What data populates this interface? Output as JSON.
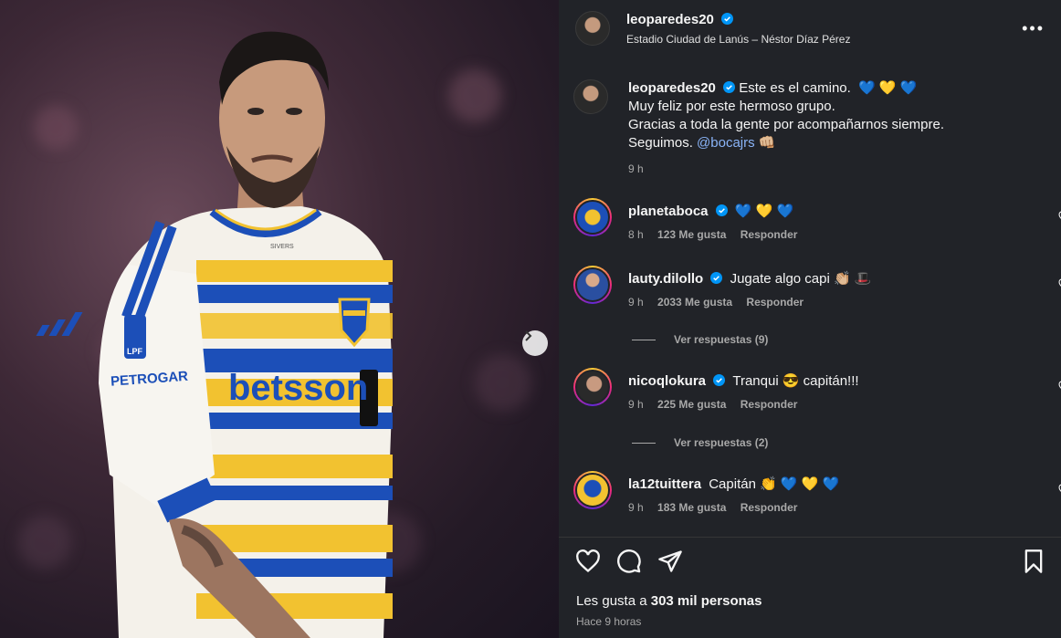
{
  "post": {
    "author": "leoparedes20",
    "location": "Estadio Ciudad de Lanús – Néstor Díaz Pérez",
    "more_label": "•••",
    "caption": {
      "author": "leoparedes20",
      "text_l1_pre": "Este es el camino.",
      "text_l1_emoji": "💙 💛 💙",
      "text_l2": "Muy feliz por este hermoso grupo.",
      "text_l3": "Gracias a toda la gente por acompañarnos siempre.",
      "text_l4": "Seguimos.",
      "mention": "@bocajrs",
      "text_l4_emoji": "👊🏼",
      "time": "9 h"
    },
    "jersey_text": "betsson",
    "sleeve_text": "PETROGAR",
    "badge_text": "LPF",
    "neck_text": "SIVERS"
  },
  "comments": [
    {
      "user": "planetaboca",
      "verified": true,
      "text": "💙 💛 💙",
      "time": "8 h",
      "likes": "123 Me gusta",
      "reply": "Responder"
    },
    {
      "user": "lauty.dilollo",
      "verified": true,
      "text": "Jugate algo capi 👏🏼 🎩",
      "time": "9 h",
      "likes": "2033 Me gusta",
      "reply": "Responder"
    },
    {
      "user": "nicoqlokura",
      "verified": true,
      "text": "Tranqui 😎 capitán!!!",
      "time": "9 h",
      "likes": "225 Me gusta",
      "reply": "Responder"
    },
    {
      "user": "la12tuittera",
      "verified": false,
      "text": "Capitán 👏 💙 💛 💙",
      "time": "9 h",
      "likes": "183 Me gusta",
      "reply": "Responder"
    }
  ],
  "view_replies": [
    "Ver respuestas (9)",
    "Ver respuestas (2)"
  ],
  "likes_prefix": "Les gusta a",
  "likes_count": "303 mil personas",
  "time_ago": "Hace 9 horas",
  "colors": {
    "panel_bg": "#212328",
    "accent_link": "#8ab4f8",
    "verified": "#0095f6",
    "boca_blue": "#1c4fb8",
    "boca_gold": "#f2c230"
  }
}
